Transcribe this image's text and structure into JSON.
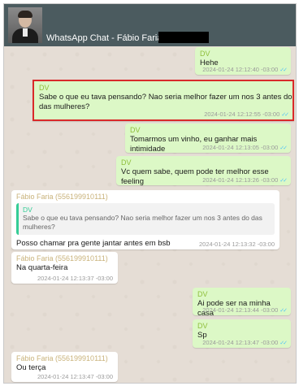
{
  "header": {
    "title": "WhatsApp Chat - Fábio Faria -"
  },
  "colors": {
    "header_bg": "#4b5b5f",
    "chat_bg": "#e5ddd5",
    "outgoing_bubble": "#dcf8c6",
    "incoming_bubble": "#ffffff",
    "highlight_border": "#d92a2a",
    "quote_accent": "#35cd96"
  },
  "messages": [
    {
      "sender": "DV",
      "text": "Hehe",
      "time": "2024-01-24 12:12:40 -03:00",
      "direction": "out"
    },
    {
      "sender": "DV",
      "text": "Sabe o que eu tava pensando? Nao seria melhor fazer um nos 3 antes do das mulheres?",
      "time": "2024-01-24 12:12:55 -03:00",
      "direction": "out",
      "highlighted": true
    },
    {
      "sender": "DV",
      "text": "Tomarmos um vinho, eu ganhar mais intimidade",
      "time": "2024-01-24 12:13:05 -03:00",
      "direction": "out"
    },
    {
      "sender": "DV",
      "text": "Vc quem sabe, quem pode ter melhor esse feeling",
      "time": "2024-01-24 12:13:26 -03:00",
      "direction": "out"
    },
    {
      "sender": "Fábio Faria (556199910111)",
      "quote": {
        "sender": "DV",
        "text": "Sabe o que eu tava pensando? Nao seria melhor fazer um nos 3 antes do das mulheres?"
      },
      "text": "Posso chamar pra gente jantar antes em bsb",
      "time": "2024-01-24 12:13:32 -03:00",
      "direction": "in"
    },
    {
      "sender": "Fábio Faria (556199910111)",
      "text": "Na quarta-feira",
      "time": "2024-01-24 12:13:37 -03:00",
      "direction": "in"
    },
    {
      "sender": "DV",
      "text": "Ai pode ser na minha casa",
      "time": "2024-01-24 12:13:44 -03:00",
      "direction": "out"
    },
    {
      "sender": "DV",
      "text": "Sp",
      "time": "2024-01-24 12:13:47 -03:00",
      "direction": "out"
    },
    {
      "sender": "Fábio Faria (556199910111)",
      "text": "Ou terça",
      "time": "2024-01-24 12:13:47 -03:00",
      "direction": "in"
    }
  ],
  "icons": {
    "read_receipt": "double-check-icon"
  }
}
